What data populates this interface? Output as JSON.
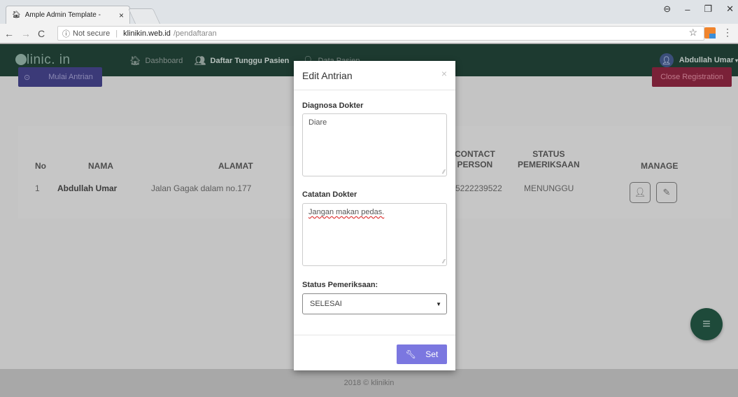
{
  "browser": {
    "tab_title": "Ample Admin Template -",
    "tab_close": "×",
    "security_label": "Not secure",
    "url_host": "klinikin.web.id",
    "url_path": "/pendaftaran",
    "window_controls": [
      "⊖",
      "–",
      "❐",
      "✕"
    ]
  },
  "nav": {
    "logo": "linic. in",
    "items": [
      {
        "label": "Dashboard",
        "icon": "home-icon"
      },
      {
        "label": "Daftar Tunggu Pasien",
        "icon": "users-icon"
      },
      {
        "label": "Data Pasien",
        "icon": "user-icon"
      }
    ],
    "user_name": "Abdullah Umar"
  },
  "actions": {
    "start_queue": "Mulai Antrian",
    "close_registration": "Close Registration"
  },
  "table": {
    "headers": {
      "no": "No",
      "nama": "NAMA",
      "alamat": "ALAMAT",
      "contact_1": "CONTACT",
      "contact_2": "PERSON",
      "status_1": "STATUS",
      "status_2": "PEMERIKSAAN",
      "manage": "MANAGE"
    },
    "rows": [
      {
        "no": "1",
        "nama": "Abdullah Umar",
        "alamat": "Jalan Gagak dalam no.177",
        "contact": "5222239522",
        "status": "MENUNGGU"
      }
    ]
  },
  "footer": {
    "text": "2018 © klinikin"
  },
  "modal": {
    "title": "Edit Antrian",
    "close": "×",
    "diagnosa_label": "Diagnosa Dokter",
    "diagnosa_value": "Diare",
    "catatan_label": "Catatan Dokter",
    "catatan_value": "Jangan makan pedas.",
    "status_label": "Status Pemeriksaan:",
    "status_value": "SELESAI",
    "set_label": "Set"
  },
  "colors": {
    "navbar": "#1d3a30",
    "primary_button": "#7b77e0",
    "close_registration": "#7a2138",
    "fab": "#1e4a3a"
  }
}
